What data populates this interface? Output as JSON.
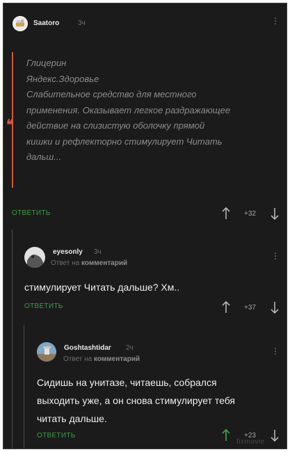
{
  "comments": [
    {
      "user": "Saatoro",
      "time": "3ч",
      "quote_lines": [
        "Глицерин",
        "Яндекс.Здоровье",
        "Слабительное средство для местного",
        "применения. Оказывает легкое раздражающее",
        "действие на слизистую оболочку прямой",
        "кишки и рефлекторно стимулирует Читать",
        "дальш..."
      ],
      "reply_label": "ОТВЕТИТЬ",
      "score": "+32"
    },
    {
      "user": "eyesonly",
      "time": "3ч",
      "reply_prefix": "Ответ на",
      "reply_link": "комментарий",
      "text": "стимулирует Читать дальше? Хм..",
      "reply_label": "ОТВЕТИТЬ",
      "score": "+37"
    },
    {
      "user": "Goshtashtidar",
      "time": "2ч",
      "reply_prefix": "Ответ на",
      "reply_link": "комментарий",
      "text_lines": [
        "Сидишь на унитазе, читаешь, собрался",
        "выходить уже, а он снова стимулирует тебя",
        "читать дальше."
      ],
      "reply_label": "ОТВЕТИТЬ",
      "score": "+23"
    }
  ],
  "colors": {
    "background": "#1b1b1c",
    "accent_green": "#39a13e",
    "quote_bar": "#d2593f"
  },
  "watermark": "fixmovie"
}
